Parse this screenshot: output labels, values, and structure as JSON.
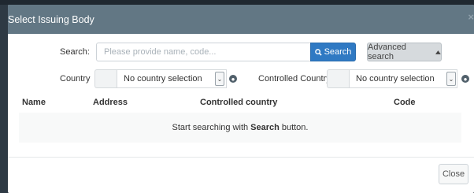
{
  "modal": {
    "title": "Select Issuing Body",
    "close_glyph": "×"
  },
  "search": {
    "label": "Search:",
    "placeholder": "Please provide name, code...",
    "button_label": "Search",
    "button_icon": "search-icon",
    "advanced_label": "Advanced search",
    "advanced_icon": "caret-up-icon"
  },
  "filters": {
    "country_label": "Country",
    "country_value": "No country selection",
    "controlled_country_label": "Controlled Country",
    "controlled_country_value": "No country selection"
  },
  "table": {
    "columns": [
      "Name",
      "Address",
      "Controlled country",
      "Code"
    ],
    "empty_prefix": "Start searching with",
    "empty_bold": "Search",
    "empty_suffix": "button."
  },
  "footer": {
    "close_label": "Close"
  },
  "colors": {
    "header_bg": "#627784",
    "primary": "#2f79c3",
    "backdrop": "#2e3a44"
  }
}
